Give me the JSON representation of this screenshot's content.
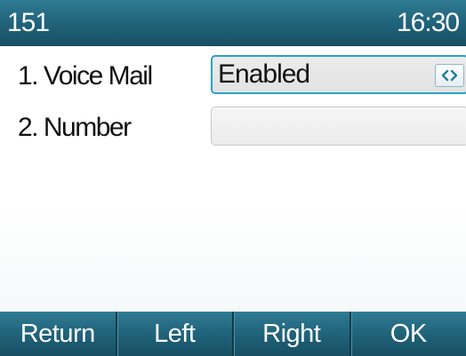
{
  "status_bar": {
    "account": "151",
    "time": "16:30"
  },
  "settings": [
    {
      "index": "1.",
      "label": "Voice Mail",
      "value": "Enabled",
      "selected": true,
      "switch_icon": "left-right-arrows-icon"
    },
    {
      "index": "2.",
      "label": "Number",
      "value": ""
    }
  ],
  "softkeys": [
    "Return",
    "Left",
    "Right",
    "OK"
  ],
  "colors": {
    "bar": "#1f6178",
    "focus_border": "#2aa3c7",
    "field_bg": "#ececec",
    "text": "#111111"
  }
}
